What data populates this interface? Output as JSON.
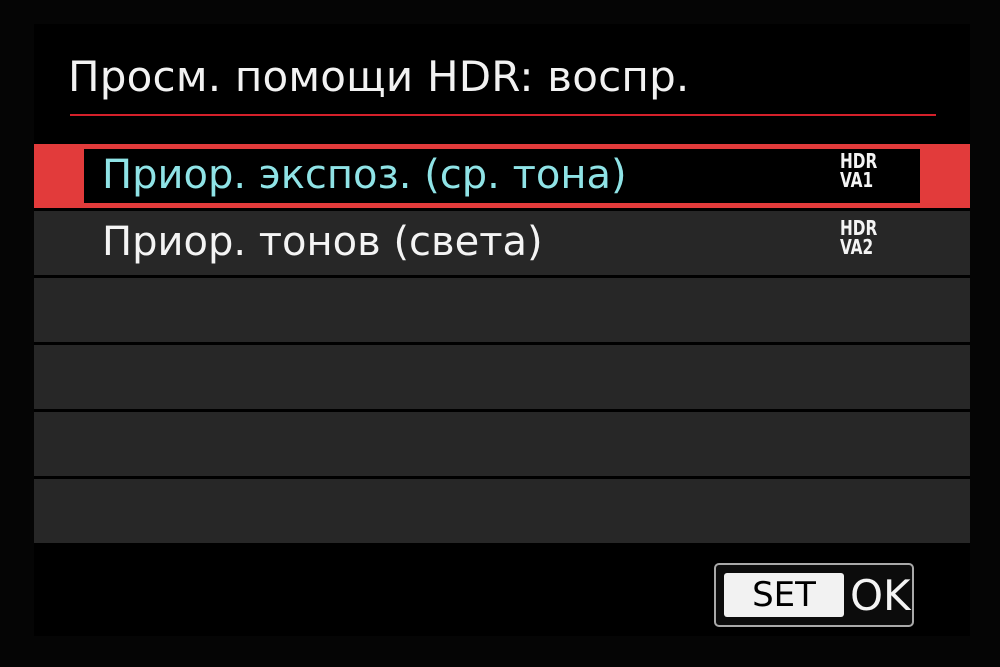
{
  "menu_title": "Просм. помощи HDR: воспр.",
  "options": [
    {
      "label": "Приор. экспоз. (ср. тона)",
      "badge_top": "HDR",
      "badge_bottom": "VA1",
      "selected": true
    },
    {
      "label": "Приор. тонов (света)",
      "badge_top": "HDR",
      "badge_bottom": "VA2",
      "selected": false
    }
  ],
  "footer": {
    "set_key_label": "SET",
    "ok_label": "OK"
  },
  "colors": {
    "accent_red": "#d4202a",
    "selection_frame": "#e23b3b",
    "selected_text": "#8fe3e6",
    "row_background": "#272727"
  }
}
